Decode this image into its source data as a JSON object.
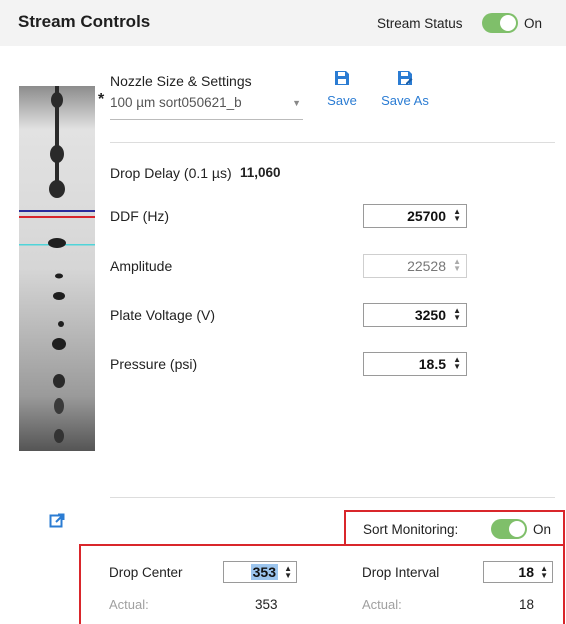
{
  "header": {
    "title": "Stream Controls",
    "stream_status_label": "Stream Status",
    "stream_status_toggle": "On"
  },
  "nozzle": {
    "label": "Nozzle Size & Settings",
    "modified_marker": "*",
    "value": "100 µm sort050621_b",
    "save_label": "Save",
    "save_as_label": "Save As"
  },
  "settings": {
    "drop_delay_label": "Drop Delay (0.1 µs)",
    "drop_delay_value": "11,060",
    "ddf_label": "DDF (Hz)",
    "ddf_value": "25700",
    "amplitude_label": "Amplitude",
    "amplitude_value": "22528",
    "plate_voltage_label": "Plate Voltage (V)",
    "plate_voltage_value": "3250",
    "pressure_label": "Pressure (psi)",
    "pressure_value": "18.5"
  },
  "sort_monitoring": {
    "label": "Sort Monitoring:",
    "toggle": "On"
  },
  "monitor": {
    "drop_center_label": "Drop Center",
    "drop_center_value": "353",
    "drop_center_actual_label": "Actual:",
    "drop_center_actual_value": "353",
    "drop_interval_label": "Drop Interval",
    "drop_interval_value": "18",
    "drop_interval_actual_label": "Actual:",
    "drop_interval_actual_value": "18"
  },
  "icons": {
    "save": "floppy-disk-icon",
    "save_as": "floppy-disk-edit-icon",
    "popout": "open-in-new-icon",
    "spin": "spin-up-down-icon"
  },
  "colors": {
    "accent": "#2b7cd3",
    "toggle_on": "#7fbf6a",
    "highlight_box": "#d9262b",
    "break_line_blue": "#2b2b9b",
    "break_line_red": "#d9262b",
    "break_line_cyan": "#4fd4d9"
  }
}
